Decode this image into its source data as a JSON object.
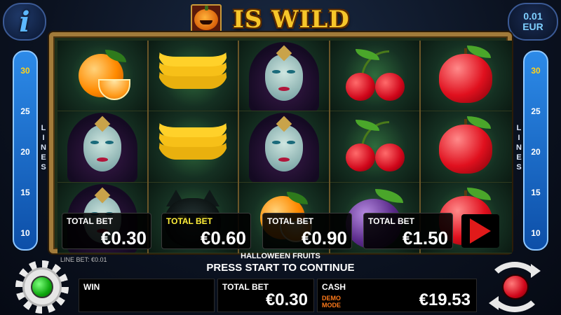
{
  "header": {
    "info_glyph": "i",
    "title": "IS WILD",
    "wild_symbol": "pumpkin-icon",
    "denomination": {
      "value": "0.01",
      "currency": "EUR"
    }
  },
  "reels": [
    [
      "orange",
      "witch",
      "witch"
    ],
    [
      "banana",
      "banana",
      "cat"
    ],
    [
      "witch",
      "witch",
      "orange"
    ],
    [
      "cherries",
      "cherries",
      "plum"
    ],
    [
      "apple",
      "apple",
      "apple"
    ]
  ],
  "lines": {
    "label": "LINES",
    "numbers": [
      "30",
      "25",
      "20",
      "15",
      "10"
    ],
    "active": "30"
  },
  "bet_options": [
    {
      "label": "TOTAL BET",
      "value": "€0.30",
      "selected": false
    },
    {
      "label": "TOTAL BET",
      "value": "€0.60",
      "selected": true
    },
    {
      "label": "TOTAL BET",
      "value": "€0.90",
      "selected": false
    },
    {
      "label": "TOTAL BET",
      "value": "€1.50",
      "selected": false
    }
  ],
  "status": {
    "game_name": "HALLOWEEN FRUITS",
    "line_bet": "LINE BET: €0.01",
    "prompt": "PRESS START TO CONTINUE"
  },
  "bottom": {
    "win_label": "WIN",
    "win_value": "",
    "total_bet_label": "TOTAL BET",
    "total_bet_value": "€0.30",
    "cash_label": "CASH",
    "cash_value": "€19.53",
    "demo_line1": "DEMO",
    "demo_line2": "MODE"
  },
  "icons": {
    "settings": "gear-icon",
    "spin": "spin-icon",
    "next": "play-arrow-icon"
  },
  "colors": {
    "accent_blue": "#2c8ae8",
    "selected_label": "#ffef3a",
    "title_gold": "#f6c62a",
    "demo_orange": "#ff7a1a",
    "spin_red": "#d0061a",
    "status_green": "#0fa80f"
  }
}
